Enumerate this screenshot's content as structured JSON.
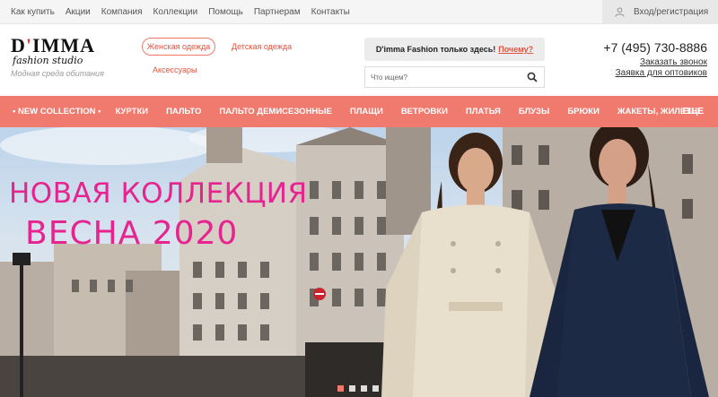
{
  "topbar": {
    "links": [
      "Как купить",
      "Акции",
      "Компания",
      "Коллекции",
      "Помощь",
      "Партнерам",
      "Контакты"
    ],
    "login_label": "Вход/регистрация"
  },
  "logo": {
    "brand_prefix": "D",
    "brand_apostrophe": "'",
    "brand_suffix": "IMMA",
    "studio": "fashion studio",
    "slogan": "Модная среда обитания"
  },
  "categories": {
    "women": "Женская одежда",
    "kids": "Детская одежда",
    "accessories": "Аксессуары"
  },
  "promo": {
    "text": "D'imma Fashion только здесь!",
    "why": "Почему?"
  },
  "search": {
    "placeholder": "Что ищем?"
  },
  "contacts": {
    "phone": "+7 (495) 730-8886",
    "callback": "Заказать звонок",
    "wholesale": "Заявка для оптовиков"
  },
  "nav": {
    "items": [
      "• NEW COLLECTION •",
      "КУРТКИ",
      "ПАЛЬТО",
      "ПАЛЬТО ДЕМИСЕЗОННЫЕ",
      "ПЛАЩИ",
      "ВЕТРОВКИ",
      "ПЛАТЬЯ",
      "БЛУЗЫ",
      "БРЮКИ",
      "ЖАКЕТЫ, ЖИЛЕТЫ",
      "ЕЩЕ"
    ]
  },
  "hero": {
    "title_line1": "НОВАЯ КОЛЛЕКЦИЯ",
    "title_line2": "ВЕСНА 2020",
    "slide_count": 4,
    "active_slide": 1
  },
  "colors": {
    "accent": "#f07a6e",
    "hero_text": "#e6238e"
  },
  "icons": {
    "login": "user-icon",
    "search": "search-icon"
  }
}
